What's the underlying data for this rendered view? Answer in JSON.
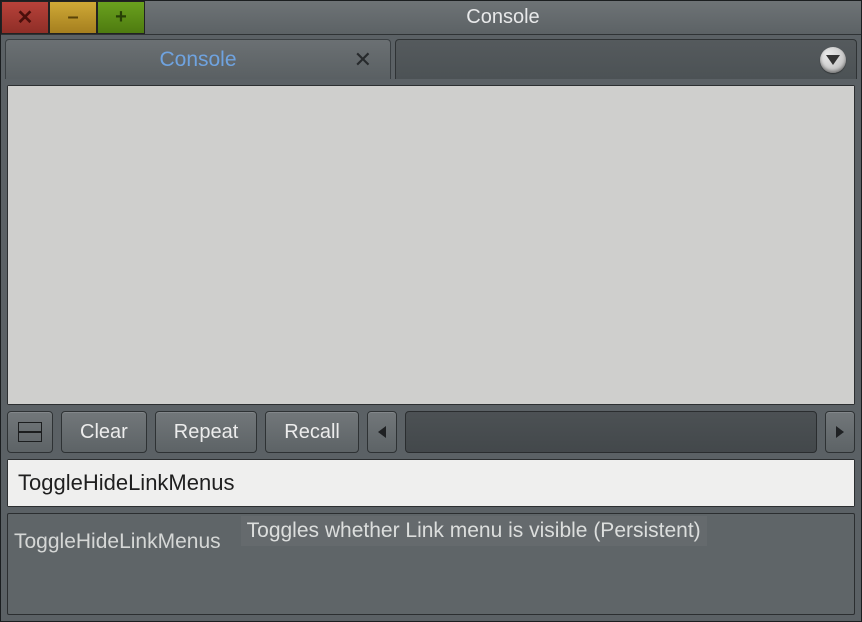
{
  "window": {
    "title": "Console"
  },
  "tabs": {
    "active_label": "Console"
  },
  "toolbar": {
    "clear_label": "Clear",
    "repeat_label": "Repeat",
    "recall_label": "Recall"
  },
  "input": {
    "value": "ToggleHideLinkMenus"
  },
  "suggestion": {
    "name": "ToggleHideLinkMenus",
    "description": "Toggles whether Link menu is visible (Persistent)"
  }
}
